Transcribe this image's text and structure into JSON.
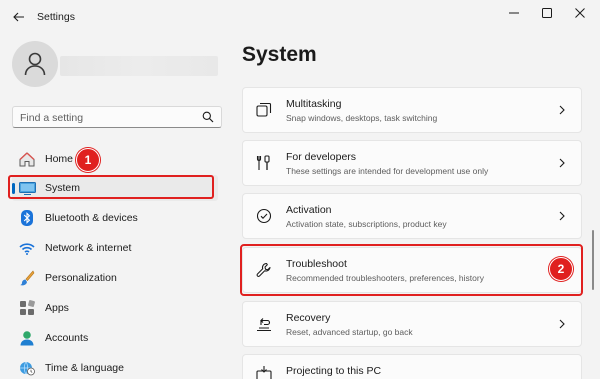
{
  "window": {
    "title": "Settings",
    "icons": {
      "back": "back-arrow-icon",
      "minimize": "minimize-icon",
      "maximize": "maximize-icon",
      "close": "close-icon"
    }
  },
  "search": {
    "placeholder": "Find a setting",
    "icon": "search-icon"
  },
  "sidebar": {
    "items": [
      {
        "label": "Home",
        "icon": "home-icon"
      },
      {
        "label": "System",
        "icon": "system-display-icon",
        "selected": true
      },
      {
        "label": "Bluetooth & devices",
        "icon": "bluetooth-icon"
      },
      {
        "label": "Network & internet",
        "icon": "wifi-icon"
      },
      {
        "label": "Personalization",
        "icon": "paintbrush-icon"
      },
      {
        "label": "Apps",
        "icon": "apps-icon"
      },
      {
        "label": "Accounts",
        "icon": "accounts-icon"
      },
      {
        "label": "Time & language",
        "icon": "globe-clock-icon"
      }
    ]
  },
  "main": {
    "title": "System",
    "cards": [
      {
        "title": "Multitasking",
        "desc": "Snap windows, desktops, task switching",
        "icon": "multitasking-icon"
      },
      {
        "title": "For developers",
        "desc": "These settings are intended for development use only",
        "icon": "developer-tools-icon"
      },
      {
        "title": "Activation",
        "desc": "Activation state, subscriptions, product key",
        "icon": "activation-check-icon"
      },
      {
        "title": "Troubleshoot",
        "desc": "Recommended troubleshooters, preferences, history",
        "icon": "wrench-icon"
      },
      {
        "title": "Recovery",
        "desc": "Reset, advanced startup, go back",
        "icon": "recovery-icon"
      },
      {
        "title": "Projecting to this PC",
        "desc": "",
        "icon": "projecting-icon"
      }
    ]
  },
  "annotations": {
    "step1": "1",
    "step2": "2",
    "color": "#e0201f"
  },
  "colors": {
    "accent": "#0067c0",
    "background": "#f3f3f3",
    "card": "#fbfbfb"
  }
}
